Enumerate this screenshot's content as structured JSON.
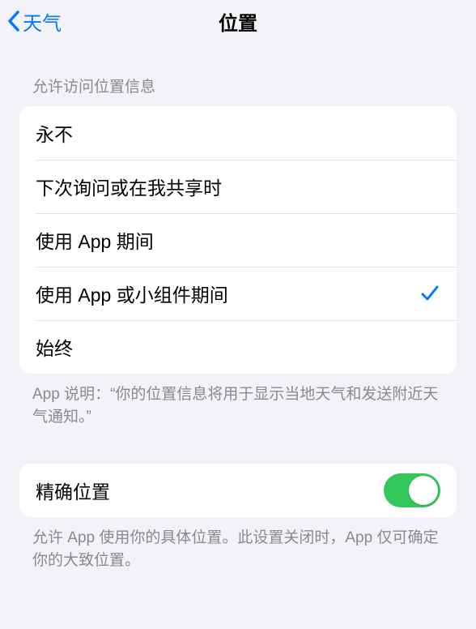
{
  "nav": {
    "back_label": "天气",
    "title": "位置"
  },
  "location_access": {
    "header": "允许访问位置信息",
    "options": {
      "never": "永不",
      "ask_next": "下次询问或在我共享时",
      "while_using": "使用 App 期间",
      "while_using_or_widgets": "使用 App 或小组件期间",
      "always": "始终"
    },
    "selected": "while_using_or_widgets",
    "footer": "App 说明：“你的位置信息将用于显示当地天气和发送附近天气通知。”"
  },
  "precise": {
    "label": "精确位置",
    "enabled": true,
    "footer": "允许 App 使用你的具体位置。此设置关闭时，App 仅可确定你的大致位置。"
  }
}
